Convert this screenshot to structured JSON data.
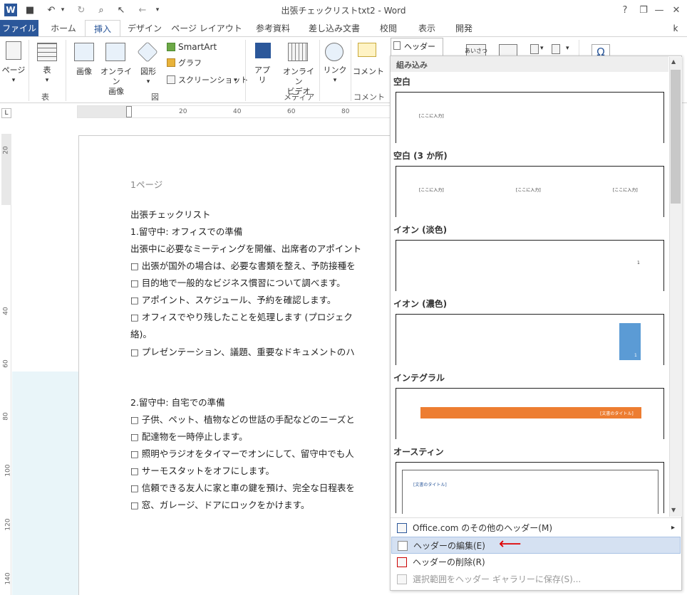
{
  "app": {
    "title": "出張チェックリストtxt2 - Word",
    "help": "?",
    "minimize": "—",
    "restore": "❐",
    "close": "✕"
  },
  "qat": {
    "word": "W",
    "save": "■",
    "undo": "↶",
    "redo": "↻",
    "preview": "⌕",
    "pointer": "↖",
    "back": "←",
    "customize": "▾"
  },
  "tabs": [
    {
      "label": "ファイル"
    },
    {
      "label": "ホーム"
    },
    {
      "label": "挿入"
    },
    {
      "label": "デザイン"
    },
    {
      "label": "ページ レイアウト"
    },
    {
      "label": "参考資料"
    },
    {
      "label": "差し込み文書"
    },
    {
      "label": "校閲"
    },
    {
      "label": "表示"
    },
    {
      "label": "開発"
    },
    {
      "label": "k"
    }
  ],
  "ribbon": {
    "page": "ページ",
    "table": "表",
    "table_group": "表",
    "picture": "画像",
    "online_picture": "オンライン\n画像",
    "shapes": "図形",
    "smartart": "SmartArt",
    "chart": "グラフ",
    "screenshot": "スクリーンショット",
    "illustrations_group": "図",
    "apps": "アプ\nリ",
    "online_video": "オンライン\nビデオ",
    "media_group": "メディア",
    "link": "リンク",
    "comment": "コメント",
    "comment_group": "コメント",
    "header": "ヘッダー",
    "greeting": "あいさつ",
    "omega": "Ω",
    "dropdown_arrow": "▾"
  },
  "ruler": {
    "corner": "L",
    "h": [
      "20",
      "40",
      "60",
      "80"
    ],
    "v": [
      "20",
      "40",
      "60",
      "80",
      "100",
      "120",
      "140"
    ]
  },
  "document": {
    "page_label": "1ページ",
    "lines": [
      "出張チェックリスト",
      "1.留守中: オフィスでの準備",
      "出張中に必要なミーティングを開催、出席者のアポイント",
      "□ 出張が国外の場合は、必要な書類を整え、予防接種を",
      "□ 目的地で一般的なビジネス慣習について調べます。",
      "□ アポイント、スケジュール、予約を確認します。",
      "□ オフィスでやり残したことを処理します (プロジェク",
      "絡)。",
      "□ プレゼンテーション、議題、重要なドキュメントのハ",
      "2.留守中: 自宅での準備",
      "□ 子供、ペット、植物などの世話の手配などのニーズと",
      "□ 配達物を一時停止します。",
      "□ 照明やラジオをタイマーでオンにして、留守中でも人",
      "□ サーモスタットをオフにします。",
      "□ 信頼できる友人に家と車の鍵を預け、完全な日程表を",
      "□ 窓、ガレージ、ドアにロックをかけます。"
    ]
  },
  "gallery": {
    "header_label": "ヘッダー",
    "category": "組み込み",
    "sections": [
      {
        "name": "空白",
        "placeholders": [
          "[ここに入力]"
        ]
      },
      {
        "name": "空白 (3 か所)",
        "placeholders": [
          "[ここに入力]",
          "[ここに入力]",
          "[ここに入力]"
        ]
      },
      {
        "name": "イオン (淡色)",
        "placeholders": [
          "1"
        ]
      },
      {
        "name": "イオン (濃色)",
        "placeholders": [
          "1"
        ]
      },
      {
        "name": "インテグラル",
        "placeholders": [
          "[文書のタイトル]"
        ]
      },
      {
        "name": "オースティン",
        "placeholders": [
          "[文書のタイトル]"
        ]
      }
    ],
    "menu": [
      {
        "label": "Office.com のその他のヘッダー(M)",
        "arrow": "▸"
      },
      {
        "label": "ヘッダーの編集(E)"
      },
      {
        "label": "ヘッダーの削除(R)"
      },
      {
        "label": "選択範囲をヘッダー ギャラリーに保存(S)..."
      }
    ],
    "scroll_up": "▲",
    "scroll_down": "▼"
  },
  "annotation": {
    "arrow": "⟵"
  },
  "colors": {
    "accent": "#2b579a",
    "orange": "#ed7d31",
    "blue_block": "#5b9bd5",
    "red_arrow": "#e00000"
  }
}
